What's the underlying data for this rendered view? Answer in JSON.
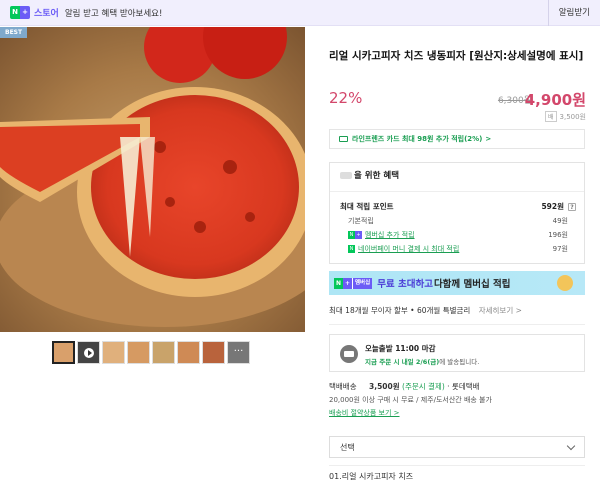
{
  "topbar": {
    "badge_n": "N",
    "badge_plus": "+",
    "store_label": "스토어",
    "message": "알림 받고 혜택 받아보세요!",
    "alarm_button": "알림받기"
  },
  "gallery": {
    "best_badge": "BEST",
    "thumbnails": [
      {
        "kind": "image",
        "icon": "pizza-thumbnail",
        "active": true
      },
      {
        "kind": "video",
        "icon": "play-icon"
      },
      {
        "kind": "image",
        "icon": "pizza-thumbnail"
      },
      {
        "kind": "image",
        "icon": "pizza-thumbnail"
      },
      {
        "kind": "image",
        "icon": "pizza-thumbnail"
      },
      {
        "kind": "image",
        "icon": "pizza-thumbnail"
      },
      {
        "kind": "image",
        "icon": "pizza-thumbnail"
      },
      {
        "kind": "more",
        "icon": "more-icon",
        "label": "···"
      }
    ]
  },
  "product": {
    "title": "리얼 시카고피자 치즈 냉동피자 [원산지:상세설명에 표시]",
    "discount": "22%",
    "original_price": "6,300원",
    "sale_price": "4,900원",
    "sub_price_tag": "배",
    "sub_price": "3,500원"
  },
  "card_promo": {
    "text": "라인프렌즈 카드 최대 98원 추가 적립(2%)",
    "arrow": ">"
  },
  "benefit": {
    "heading": "을 위한 혜택",
    "max_points_label": "최대 적립 포인트",
    "max_points_value": "592원",
    "help": "?",
    "rows": [
      {
        "label": "기본적립",
        "value": "49원"
      },
      {
        "label": "멤버십 추가 적립",
        "value": "196원"
      },
      {
        "label": "네이버페이 머니 결제 시 최대 적립",
        "value": "97원"
      }
    ]
  },
  "membership": {
    "badge_label": "멤버십",
    "text_purple": "무료 초대하고",
    "text_dark": "다함께 멤버십 적립"
  },
  "installment": {
    "text": "최대 18개월 무이자 할부 • 60개월 특별금리",
    "more": "자세히보기 >"
  },
  "delivery": {
    "line1": "오늘출발 11:00 마감",
    "line2_green": "지금 주문 시 내일 2/6(금)",
    "line2_rest": "에 발송됩니다."
  },
  "shipping": {
    "label": "택배배송",
    "fee": "3,500원",
    "fee_note": "(주문시 결제)",
    "carrier": "· 롯데택배",
    "condition": "20,000원 이상 구매 시 무료 / 제주/도서산간 배송 불가",
    "link": "배송비 절약상품 보기 >"
  },
  "option_select": {
    "placeholder": "선택"
  },
  "options": [
    {
      "label": "01.리얼 시카고피자 치즈"
    }
  ],
  "colors": {
    "accent_price": "#d3476b",
    "naver_green": "#03c75a",
    "purple": "#6b5cf6",
    "link_green": "#1a9e52"
  }
}
